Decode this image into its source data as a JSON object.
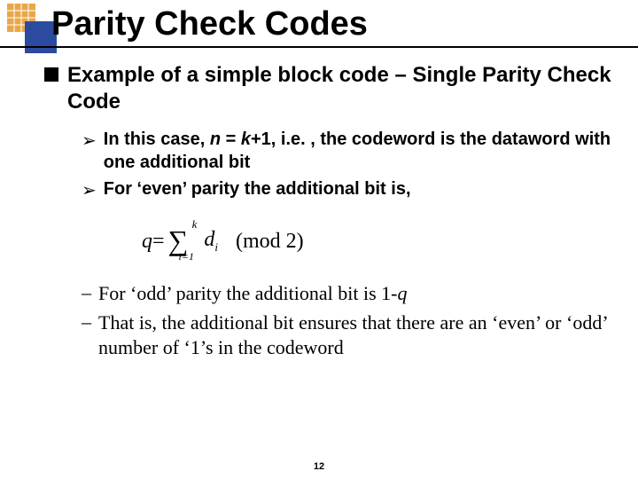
{
  "title": "Parity Check Codes",
  "main_bullet": "Example of a simple block code – Single Parity Check Code",
  "sub_bullets": [
    {
      "pre": "In this case, ",
      "n": "n",
      "mid": " = ",
      "k": "k",
      "post": "+1, i.e. , the codeword is the dataword with one additional bit"
    },
    {
      "text": "For ‘even’ parity the additional bit is,"
    }
  ],
  "formula": {
    "q": "q",
    "eq": " = ",
    "sigma": "∑",
    "upper": "k",
    "lower": "i=1",
    "d": "d",
    "d_sub": "i",
    "mod": "(mod 2)"
  },
  "dash_bullets": [
    {
      "pre": "For ‘odd’ parity the additional bit is 1-",
      "q": "q"
    },
    {
      "text": "That is, the additional bit ensures that there are an ‘even’ or ‘odd’ number of ‘1’s in the codeword"
    }
  ],
  "page_number": "12"
}
